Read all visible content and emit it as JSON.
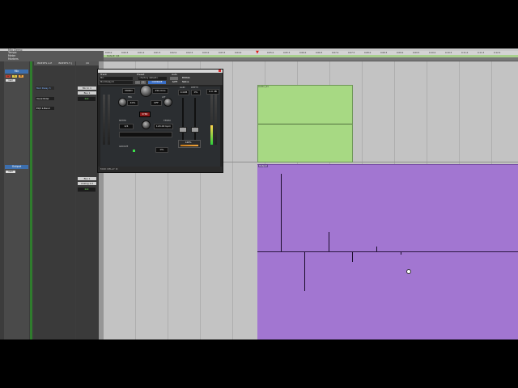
{
  "window": {
    "title": "Mix Demo"
  },
  "ruler_labels": [
    "Tempo",
    "Meter",
    "Markers"
  ],
  "timeline_ticks": [
    "0:00.0",
    "0:00.5",
    "0:01.0",
    "0:01.5",
    "0:02.0",
    "0:02.5",
    "0:03.0",
    "0:03.5",
    "0:04.0",
    "0:04.5",
    "0:05.0",
    "0:05.5",
    "0:06.0",
    "0:06.5",
    "0:07.0",
    "0:07.5",
    "0:08.0",
    "0:08.5",
    "0:09.0",
    "0:09.5",
    "0:10.0",
    "0:10.5",
    "0:11.0",
    "0:11.5",
    "0:12.0",
    "0:12.5"
  ],
  "tempo_lane": {
    "label": "Default: 4/4"
  },
  "mixer": {
    "headers": {
      "strip": "",
      "inserts_a": "INSERTS A-E",
      "inserts_b": "INSERTS F-J",
      "io": "I/O"
    },
    "tracks": [
      {
        "name": "Mic",
        "inserts": [
          "Mod Delay 3",
          "Vocal Rider",
          "EQ3 1-Band"
        ],
        "input": "Mic In 1",
        "output": "Bus 1",
        "level": "0.0",
        "pan": "0.0",
        "rec_button": "rec",
        "solo_button": "S",
        "mute_button": "M",
        "read_mode": "read"
      },
      {
        "name": "Output",
        "inserts": [],
        "input": "Bus 1",
        "output": "Analog 1-2",
        "level": "0.0",
        "pan": "0.0",
        "read_mode": "read"
      }
    ]
  },
  "clips": {
    "audio": {
      "label": "Audio_01"
    },
    "midi": {
      "label": "Output"
    }
  },
  "plugin": {
    "header": {
      "track_label": "Track",
      "preset_label": "Preset",
      "auto_label": "Auto",
      "track_value": "Mic",
      "insert_value": "Mod Delay III",
      "preset_value": "<factory default>",
      "bypass": "BYPASS",
      "compare": "COMPARE",
      "safe": "SAFE",
      "native": "Native",
      "minus": "-",
      "plus": "+",
      "compare_value": "COMPARE"
    },
    "controls": {
      "mode": "MONO",
      "delay_time": "250.0ms",
      "fbk_label": "FBK",
      "fbk_value": "40%",
      "lpf_label": "LPF",
      "lpf_value": "OFF",
      "gain_label": "GAIN",
      "depth_label": "DEPTH",
      "gain_value": "0.0dB",
      "depth_value": "0%",
      "sync": "SYNC",
      "meter_label": "METER",
      "tempo_label": "TEMPO",
      "meter_value": "4/4",
      "tempo_value": "120.00 bpm",
      "groove_label": "GROOVE",
      "groove_value": "0%",
      "mix_value": "100%",
      "out_value": "0.0 dB"
    },
    "footer": {
      "name": "MOD DELAY III"
    }
  },
  "cursor": {
    "icon": "hand-cursor-icon"
  }
}
